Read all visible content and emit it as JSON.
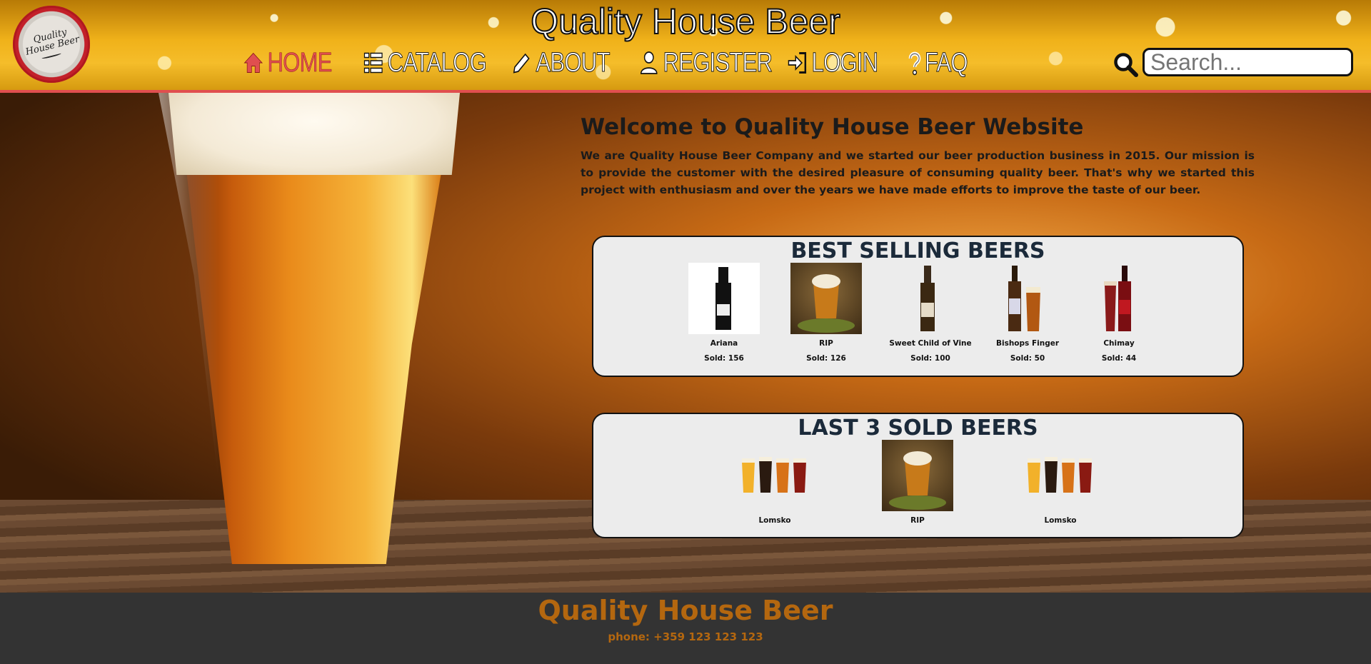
{
  "header": {
    "site_title": "Quality House Beer",
    "logo_text": "Quality House Beer",
    "nav": [
      {
        "label": "HOME",
        "icon": "home-icon",
        "active": true
      },
      {
        "label": "CATALOG",
        "icon": "list-icon",
        "active": false
      },
      {
        "label": "ABOUT",
        "icon": "pencil-icon",
        "active": false
      },
      {
        "label": "REGISTER",
        "icon": "user-icon",
        "active": false
      },
      {
        "label": "LOGIN",
        "icon": "sign-in-icon",
        "active": false
      },
      {
        "label": "FAQ",
        "icon": "question-icon",
        "active": false
      }
    ],
    "search_placeholder": "Search...",
    "accent_color": "#e04f4f"
  },
  "welcome": {
    "title": "Welcome to Quality House Beer Website",
    "text": "We are Quality House Beer Company and we started our beer production business in 2015. Our mission is to provide the customer with the desired pleasure of consuming quality beer. That's why we started this project with enthusiasm and over the years we have made efforts to improve the taste of our beer."
  },
  "best_selling": {
    "title": "BEST SELLING BEERS",
    "items": [
      {
        "name": "Ariana",
        "sold": "Sold: 156"
      },
      {
        "name": "RIP",
        "sold": "Sold: 126"
      },
      {
        "name": "Sweet Child of Vine",
        "sold": "Sold: 100"
      },
      {
        "name": "Bishops Finger",
        "sold": "Sold: 50"
      },
      {
        "name": "Chimay",
        "sold": "Sold: 44"
      }
    ]
  },
  "last_sold": {
    "title": "LAST 3 SOLD BEERS",
    "items": [
      {
        "name": "Lomsko"
      },
      {
        "name": "RIP"
      },
      {
        "name": "Lomsko"
      }
    ]
  },
  "footer": {
    "title": "Quality House Beer",
    "phone": "phone: +359 123 123 123",
    "color": "#b4670f"
  }
}
